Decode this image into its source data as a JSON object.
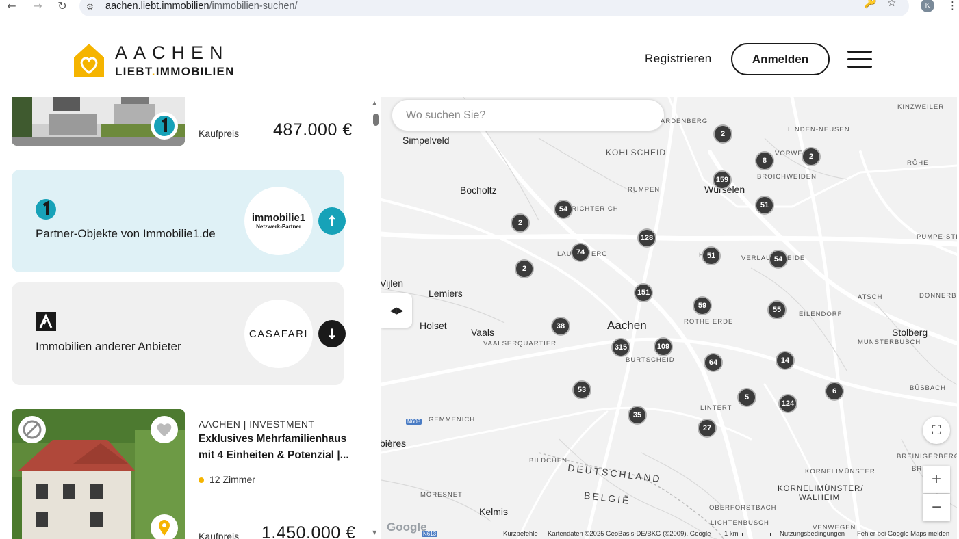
{
  "browser": {
    "url_host": "aachen.liebt.immobilien",
    "url_path": "/immobilien-suchen/",
    "profile_initial": "K",
    "icons": [
      "back-arrow-icon",
      "forward-arrow-icon",
      "reload-icon",
      "site-info-icon",
      "key-icon",
      "star-icon",
      "kebab-menu-icon"
    ]
  },
  "header": {
    "logo_top": "AACHEN",
    "logo_bottom_left": "LIEBT",
    "logo_bottom_dot": ".",
    "logo_bottom_right": "IMMOBILIEN",
    "register_label": "Registrieren",
    "login_label": "Anmelden",
    "brand_color": "#f5b400"
  },
  "listing": {
    "first_card": {
      "price_label": "Kaufpreis",
      "price_value": "487.000 €"
    },
    "partner_immobilie1": {
      "title": "Partner-Objekte von Immobilie1.de",
      "logo_main": "immobilie1",
      "logo_sub": "Netzwerk-Partner",
      "bg_color": "#dff1f6",
      "accent_color": "#17a2b8",
      "arrow": "arrow-up-icon"
    },
    "partner_casafari": {
      "title": "Immobilien anderer Anbieter",
      "logo_main": "CASAFARI",
      "bg_color": "#f0f0f0",
      "accent_color": "#1a1a1a",
      "arrow": "arrow-down-icon"
    },
    "second_card": {
      "location": "AACHEN | INVESTMENT",
      "title": "Exklusives Mehrfamilienhaus mit 4 Einheiten & Potenzial |...",
      "rooms": "12 Zimmer",
      "price_label": "Kaufpreis",
      "price_value": "1.450.000 €"
    }
  },
  "map": {
    "search_placeholder": "Wo suchen Sie?",
    "places": {
      "simpelveld": "Simpelveld",
      "kohlscheid": "KOHLSCHEID",
      "bocholtz": "Bocholtz",
      "richterich": "RICHTERICH",
      "rumpen": "RUMPEN",
      "wuerselen": "Würselen",
      "broichweiden": "BROICHWEIDEN",
      "linden_neusen": "LINDEN-NEUSEN",
      "kinzweiler": "KINZWEILER",
      "vorweiden": "VORWEI",
      "roehe": "RÖHE",
      "pumpe_stich": "PUMPE-STIC",
      "laurensberg": "LAU",
      "laurensberg_end": "ERG",
      "haaren": "H",
      "verlautenheide": "VERLAU",
      "verlautenheide_end": "EIDE",
      "atsch": "ATSCH",
      "donnerberg": "DONNERBE",
      "vijlen": "Vijlen",
      "lemiers": "Lemiers",
      "holset": "Holset",
      "vaals": "Vaals",
      "vaalserquartier": "VAALSERQUARTIER",
      "aachen": "Aachen",
      "rothe_erde": "ROTHE ERDE",
      "eilendorf": "EILENDORF",
      "stolberg": "Stolberg",
      "muensterbusch": "MÜNSTERBUSCH",
      "burtscheid": "BURTSCHEID",
      "buesbach": "BÜSBACH",
      "gemmenich": "GEMMENICH",
      "lintert": "LINTERT",
      "plombieres": "bières",
      "bildchen": "BILDCHEN",
      "deutschland": "DEUTSCHLAND",
      "belgie": "BELGIË",
      "breinigerberg": "BREINIGERBERG",
      "breinig": "BREINIG",
      "kornelimuenster_d": "KORNELIMÜNSTER",
      "kornelimuenster_walheim_1": "KORNELIMÜNSTER/",
      "kornelimuenster_walheim_2": "WALHEIM",
      "moresnet": "MORESNET",
      "kelmis": "Kelmis",
      "oberforstbach": "OBERFORSTBACH",
      "lichtenbusch": "LICHTENBUSCH",
      "venwegen": "VENWEGEN",
      "ardenberg": "ARDENBERG"
    },
    "clusters": [
      {
        "count": "2"
      },
      {
        "count": "8"
      },
      {
        "count": "2"
      },
      {
        "count": "159"
      },
      {
        "count": "51"
      },
      {
        "count": "54"
      },
      {
        "count": "2"
      },
      {
        "count": "128"
      },
      {
        "count": "74"
      },
      {
        "count": "51"
      },
      {
        "count": "54"
      },
      {
        "count": "2"
      },
      {
        "count": "151"
      },
      {
        "count": "59"
      },
      {
        "count": "55"
      },
      {
        "count": "38"
      },
      {
        "count": "315"
      },
      {
        "count": "109"
      },
      {
        "count": "64"
      },
      {
        "count": "14"
      },
      {
        "count": "53"
      },
      {
        "count": "5"
      },
      {
        "count": "124"
      },
      {
        "count": "6"
      },
      {
        "count": "35"
      },
      {
        "count": "27"
      }
    ],
    "road_shields": {
      "n608": "N608",
      "n613": "N613"
    },
    "footer": {
      "google": "Google",
      "shortcuts": "Kurzbefehle",
      "map_data": "Kartendaten ©2025 GeoBasis-DE/BKG (©2009), Google",
      "scale": "1 km",
      "terms": "Nutzungsbedingungen",
      "report": "Fehler bei Google Maps melden"
    },
    "zoom_in": "+",
    "zoom_out": "−"
  }
}
